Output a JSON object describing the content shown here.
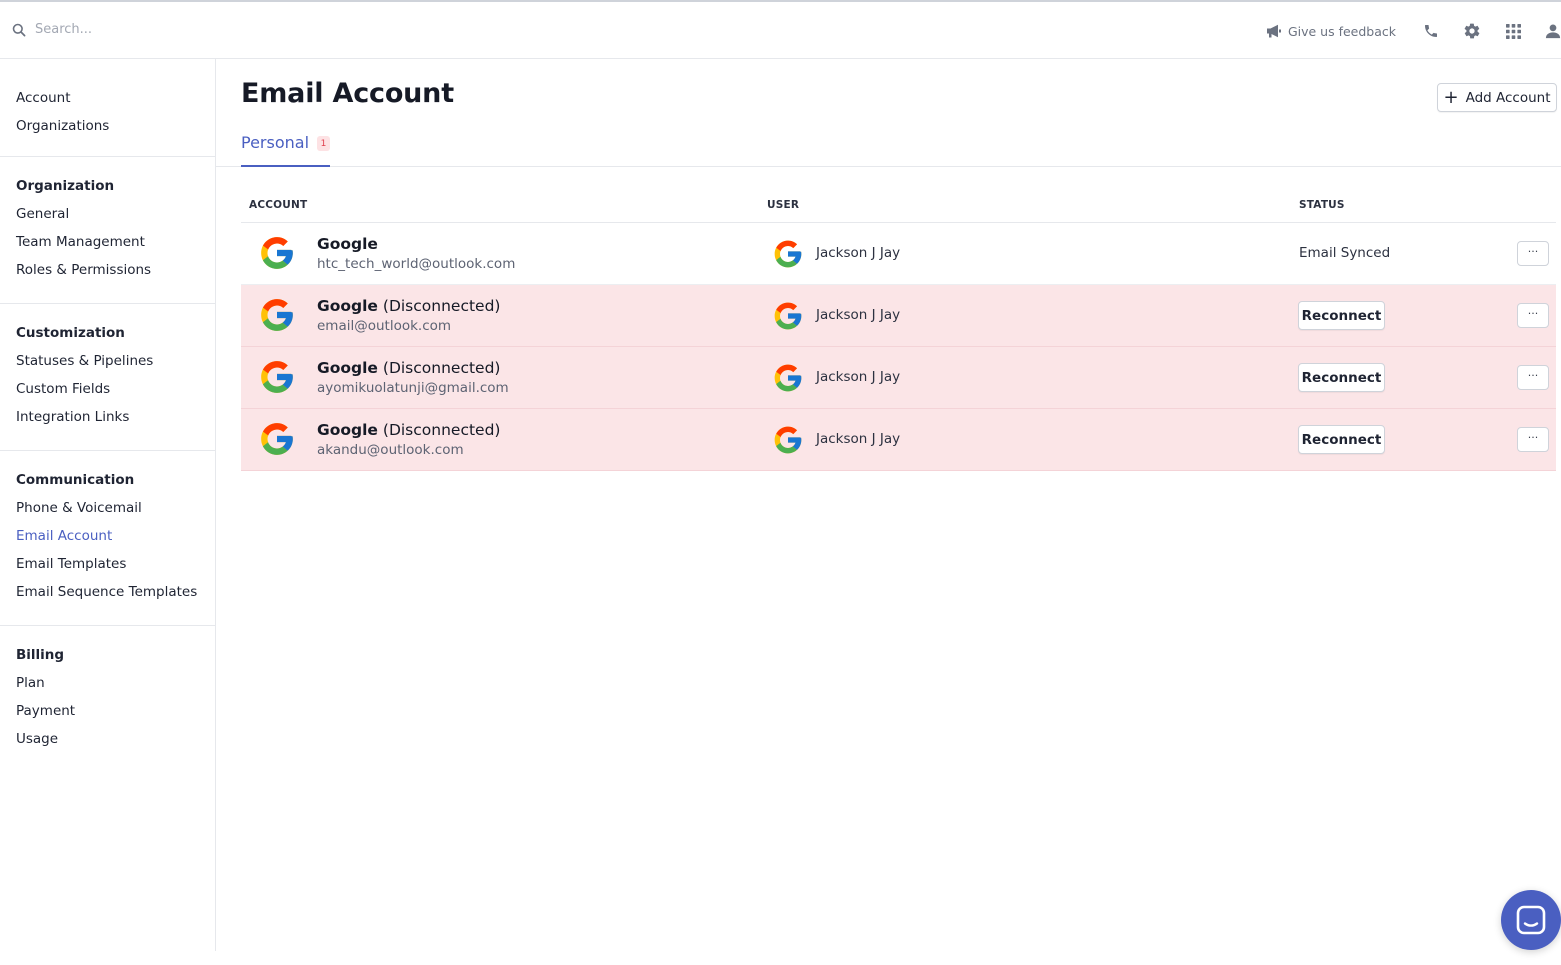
{
  "header": {
    "search_placeholder": "Search...",
    "feedback_label": "Give us feedback",
    "icons": [
      "search-icon",
      "megaphone-icon",
      "phone-icon",
      "gear-icon",
      "apps-grid-icon",
      "user-icon"
    ]
  },
  "sidebar": {
    "groups": [
      {
        "heading": "",
        "items": [
          "Account",
          "Organizations"
        ]
      },
      {
        "heading": "Organization",
        "items": [
          "General",
          "Team Management",
          "Roles & Permissions"
        ]
      },
      {
        "heading": "Customization",
        "items": [
          "Statuses & Pipelines",
          "Custom Fields",
          "Integration Links"
        ]
      },
      {
        "heading": "Communication",
        "items": [
          "Phone & Voicemail",
          "Email Account",
          "Email Templates",
          "Email Sequence Templates"
        ]
      },
      {
        "heading": "Billing",
        "items": [
          "Plan",
          "Payment",
          "Usage"
        ]
      }
    ],
    "active_item": "Email Account"
  },
  "main": {
    "title": "Email Account",
    "add_button_label": "Add Account",
    "tabs": [
      {
        "label": "Personal",
        "badge": "1"
      }
    ],
    "table": {
      "columns": [
        "ACCOUNT",
        "USER",
        "STATUS"
      ],
      "rows": [
        {
          "provider": "Google",
          "suffix": "",
          "email": "htc_tech_world@outlook.com",
          "user": "Jackson J Jay",
          "status": "Email Synced",
          "action": ""
        },
        {
          "provider": "Google",
          "suffix": "(Disconnected)",
          "email": "email@outlook.com",
          "user": "Jackson J Jay",
          "status": "",
          "action": "Reconnect"
        },
        {
          "provider": "Google",
          "suffix": "(Disconnected)",
          "email": "ayomikuolatunji@gmail.com",
          "user": "Jackson J Jay",
          "status": "",
          "action": "Reconnect"
        },
        {
          "provider": "Google",
          "suffix": "(Disconnected)",
          "email": "akandu@outlook.com",
          "user": "Jackson J Jay",
          "status": "",
          "action": "Reconnect"
        }
      ],
      "more_label": "···"
    }
  },
  "colors": {
    "accent": "#4a5fc1",
    "disconnected_row": "#fbe5e7",
    "badge_bg": "#fde2e4",
    "badge_text": "#e0404f"
  }
}
